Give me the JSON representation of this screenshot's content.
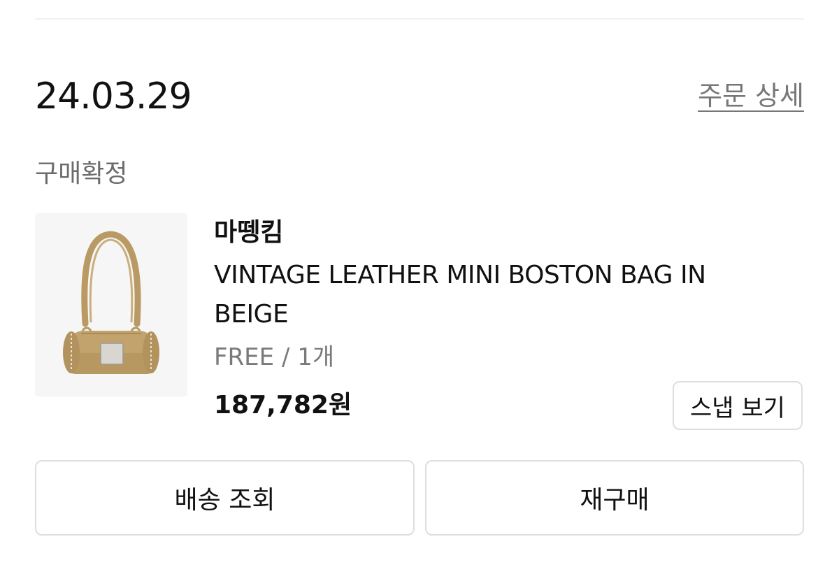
{
  "order": {
    "date": "24.03.29",
    "detail_link_label": "주문 상세",
    "status": "구매확정"
  },
  "product": {
    "image_icon": "handbag-image",
    "brand": "마뗑킴",
    "name": "VINTAGE LEATHER MINI BOSTON BAG IN BEIGE",
    "option": "FREE / 1개",
    "price": "187,782원",
    "colors": {
      "bag": "#c2a36e",
      "bag_shadow": "#a98a55",
      "plate": "#d9d6d2"
    }
  },
  "actions": {
    "snap_label": "스냅 보기",
    "delivery_label": "배송 조회",
    "rebuy_label": "재구매"
  }
}
